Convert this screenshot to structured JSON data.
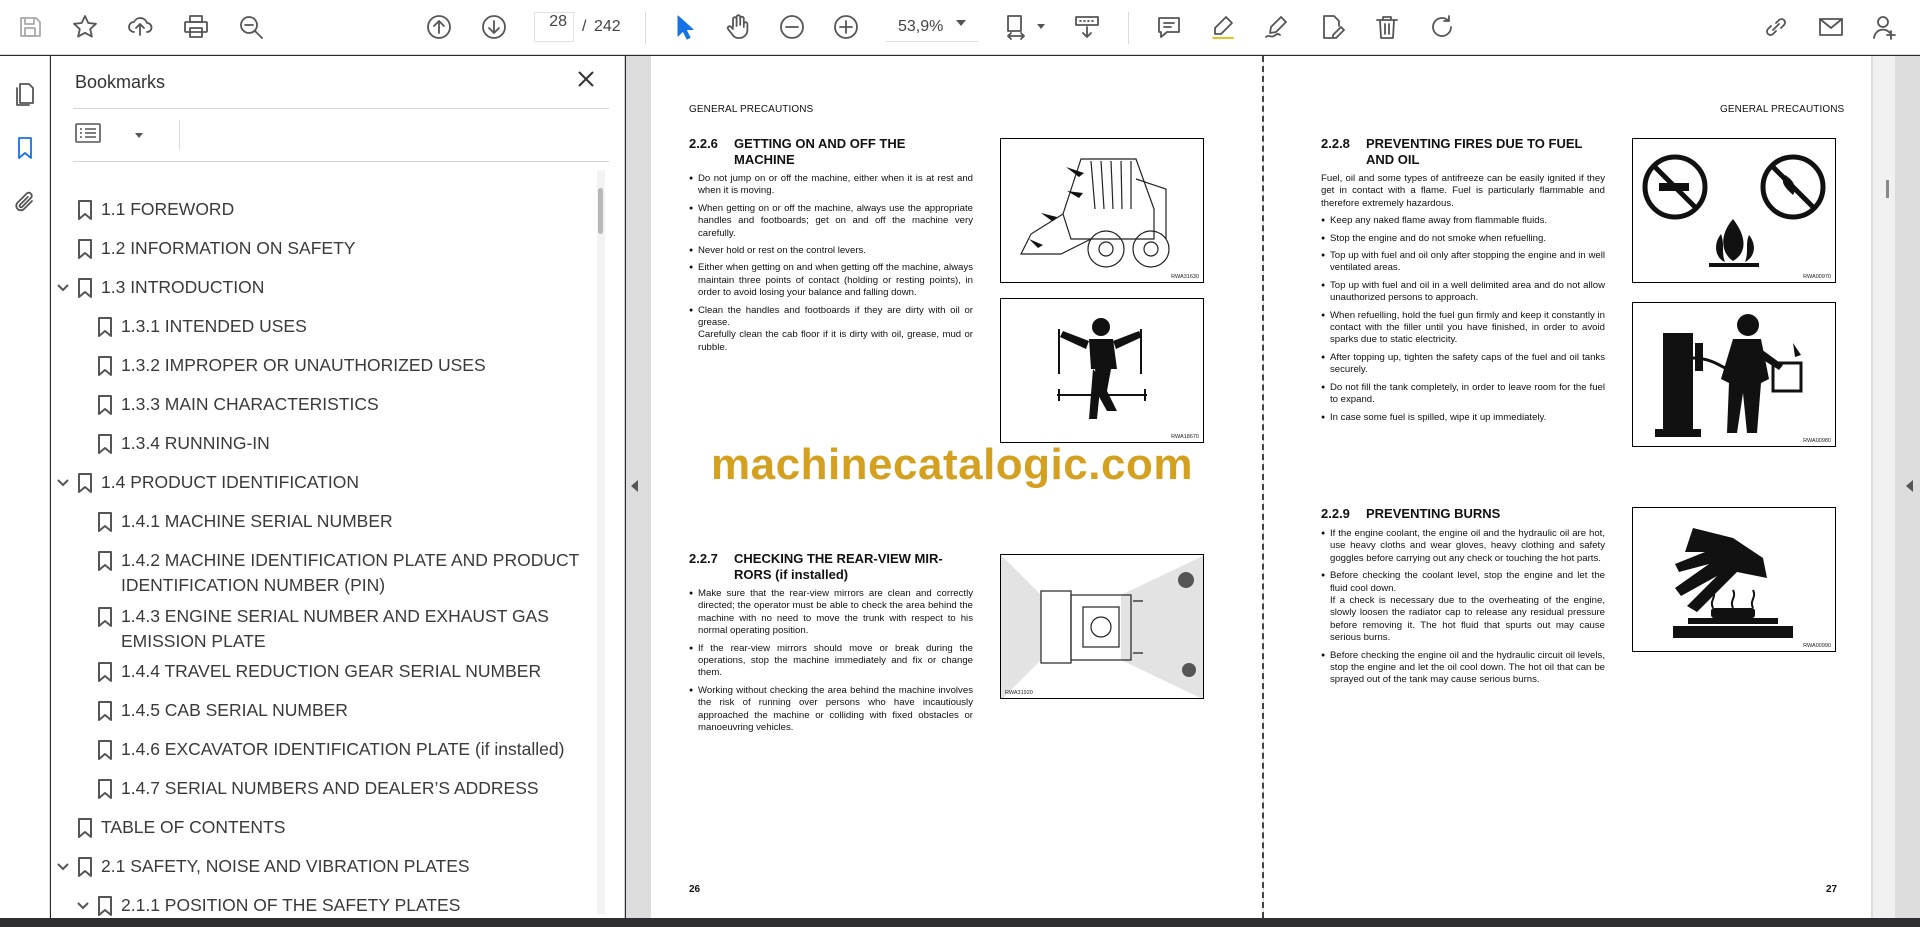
{
  "toolbar": {
    "current_page": "28",
    "page_separator": "/",
    "total_pages": "242",
    "zoom": "53,9%"
  },
  "bookmarks": {
    "title": "Bookmarks",
    "items": [
      {
        "label": "1.1 FOREWORD"
      },
      {
        "label": "1.2 INFORMATION ON SAFETY"
      },
      {
        "label": "1.3 INTRODUCTION"
      },
      {
        "label": "1.3.1 INTENDED USES"
      },
      {
        "label": "1.3.2 IMPROPER OR UNAUTHORIZED USES"
      },
      {
        "label": "1.3.3 MAIN CHARACTERISTICS"
      },
      {
        "label": "1.3.4 RUNNING-IN"
      },
      {
        "label": "1.4 PRODUCT IDENTIFICATION"
      },
      {
        "label": "1.4.1 MACHINE SERIAL NUMBER"
      },
      {
        "label": "1.4.2 MACHINE IDENTIFICATION PLATE AND PRODUCT IDENTIFICATION NUMBER (PIN)"
      },
      {
        "label": "1.4.3 ENGINE SERIAL NUMBER AND EXHAUST GAS EMISSION PLATE"
      },
      {
        "label": "1.4.4 TRAVEL REDUCTION GEAR SERIAL NUMBER"
      },
      {
        "label": "1.4.5 CAB SERIAL NUMBER"
      },
      {
        "label": "1.4.6 EXCAVATOR IDENTIFICATION PLATE (if installed)"
      },
      {
        "label": "1.4.7 SERIAL NUMBERS AND DEALER’S ADDRESS"
      },
      {
        "label": "TABLE OF CONTENTS"
      },
      {
        "label": "2.1 SAFETY, NOISE AND VIBRATION PLATES"
      },
      {
        "label": "2.1.1 POSITION OF THE SAFETY PLATES"
      }
    ]
  },
  "watermark": "machinecatalogic.com",
  "left_page": {
    "header": "GENERAL PRECAUTIONS",
    "page_number": "26",
    "s226": {
      "num": "2.2.6",
      "title_l1": "GETTING ON AND OFF THE",
      "title_l2": "MACHINE",
      "items": [
        "Do not jump on or off the machine, either when it is at rest and when it is moving.",
        "When getting on or off the machine, always use the appropriate handles and footboards; get on and off the machine very carefully.",
        "Never hold or rest on the control levers.",
        "Either when getting on and when getting off the machine, always maintain three points of contact (holding or resting points), in order to avoid losing your balance and falling down.",
        "Clean the handles and footboards if they are dirty with oil or grease.",
        "Carefully clean the cab floor if it is dirty with oil, grease, mud or rubble."
      ],
      "fig1_code": "RWA31630",
      "fig2_code": "RWA18670"
    },
    "s227": {
      "num": "2.2.7",
      "title_l1": "CHECKING THE REAR-VIEW MIR-",
      "title_l2": "RORS (if installed)",
      "items": [
        "Make sure that the rear-view mirrors are clean and correctly directed; the operator must be able to check the area behind the machine with no need to move the trunk with respect to his normal operating position.",
        "If the rear-view mirrors should move or break during the operations, stop the machine immediately and fix or change them.",
        "Working without checking the area behind the machine involves the risk of running over persons who have incautiously approached the machine or colliding with fixed obstacles or manoeuvring vehicles."
      ],
      "fig_code": "RWA31920"
    }
  },
  "right_page": {
    "header": "GENERAL PRECAUTIONS",
    "page_number": "27",
    "s228": {
      "num": "2.2.8",
      "title_l1": "PREVENTING FIRES DUE TO FUEL",
      "title_l2": "AND OIL",
      "intro": "Fuel, oil and some types of antifreeze can be easily ignited if they get in contact with a flame. Fuel is particularly flammable and therefore extremely hazardous.",
      "items": [
        "Keep any naked flame away from flammable fluids.",
        "Stop the engine and do not smoke when refuelling.",
        "Top up with fuel and oil only after stopping the engine and in well ventilated areas.",
        "Top up with fuel and oil in a well delimited area and do not allow unauthorized persons to approach.",
        "When refuelling, hold the fuel gun firmly and keep it constantly in contact with the filler until you have finished, in order to avoid sparks due to static electricity.",
        "After topping up, tighten the safety caps of the fuel and oil tanks securely.",
        "Do not fill the tank completely, in order to leave room for the fuel to expand.",
        "In case some fuel is spilled, wipe it up immediately."
      ],
      "fig1_code": "RWA00970",
      "fig2_code": "RWA00980"
    },
    "s229": {
      "num": "2.2.9",
      "title": "PREVENTING BURNS",
      "items": [
        "If the engine coolant, the engine oil and the hydraulic oil are hot, use heavy cloths and wear gloves, heavy clothing and safety goggles before carrying out any check or touching the hot parts.",
        "Before checking the coolant level, stop the engine and let the fluid cool down.",
        "If a check is necessary due to the overheating of the engine, slowly loosen the radiator cap to release any residual pressure before removing it. The hot fluid that spurts out may cause serious burns.",
        "Before checking the engine oil and the hydraulic circuit oil levels, stop the engine and let the oil cool down. The hot oil that can be sprayed out of the tank may cause serious burns."
      ],
      "fig_code": "RWA00990"
    }
  },
  "colors": {
    "accent": "#1473e6",
    "watermark": "#d4a020"
  }
}
